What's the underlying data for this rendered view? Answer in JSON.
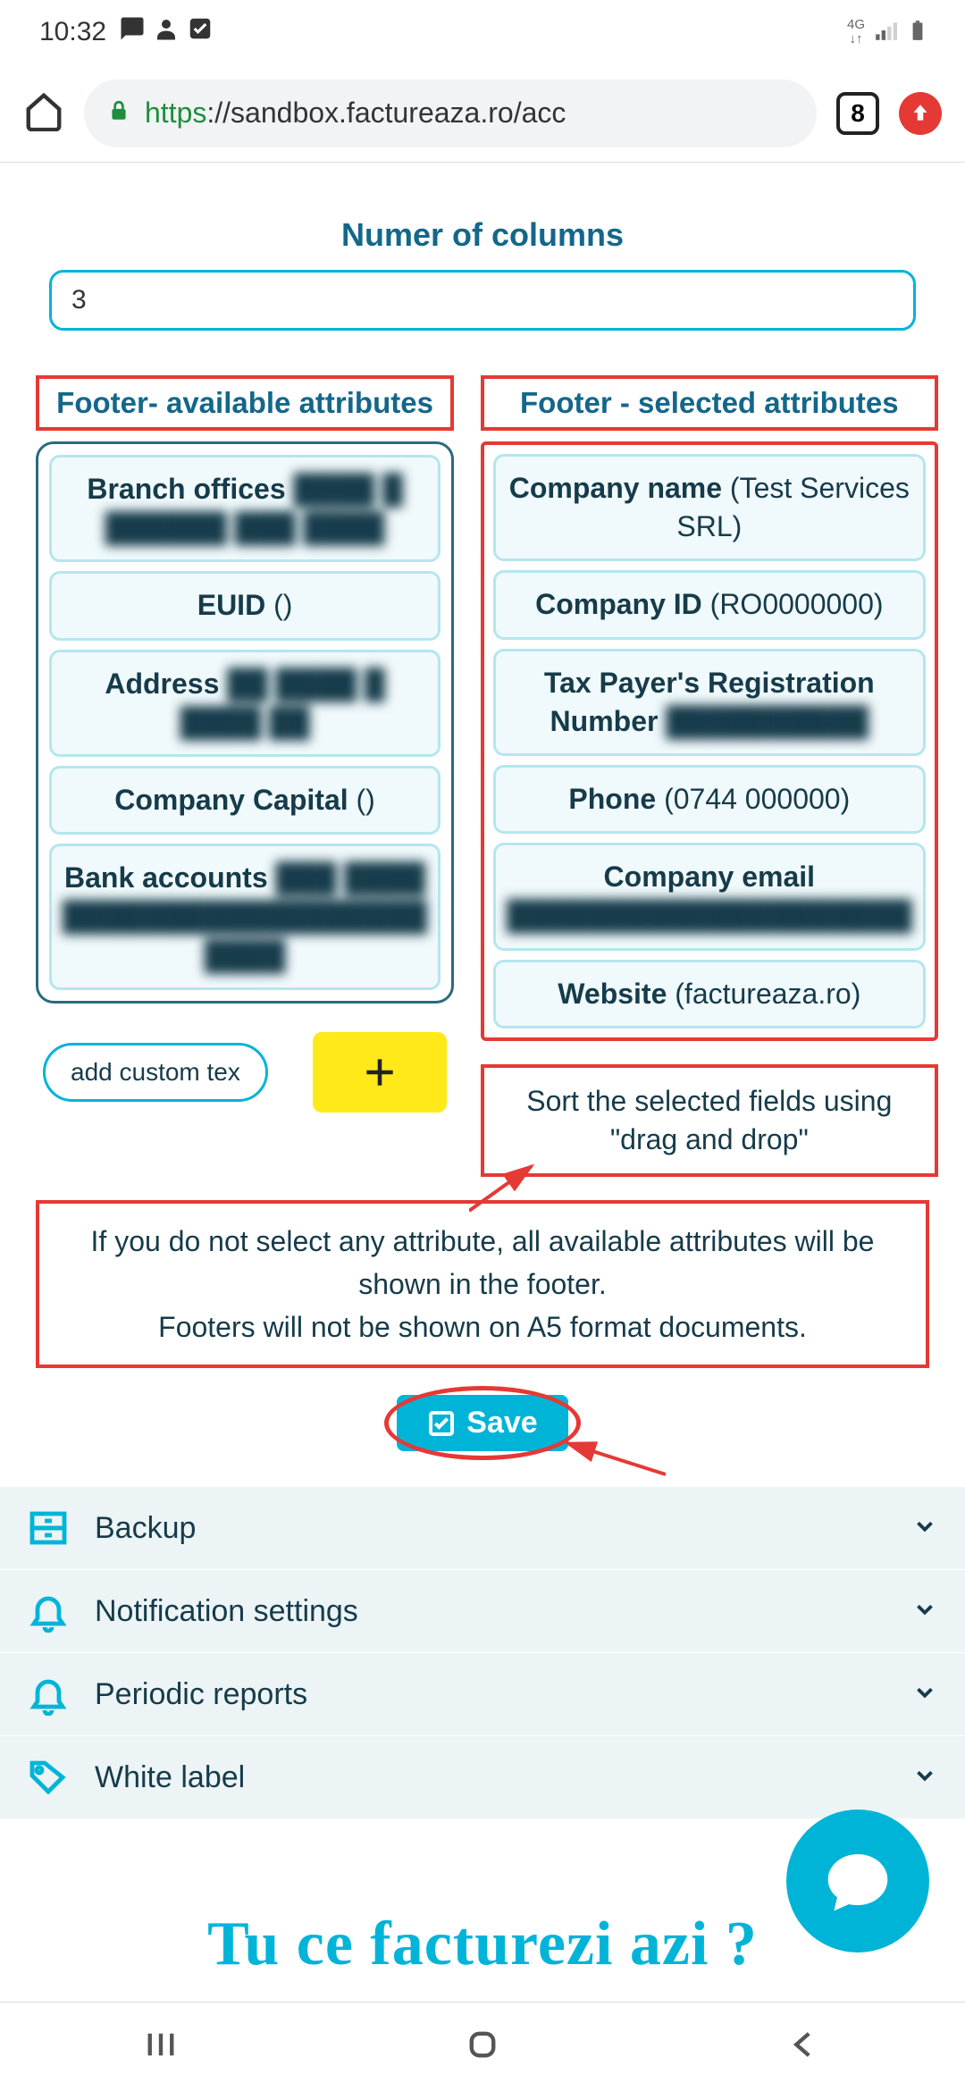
{
  "status": {
    "time": "10:32",
    "network": "4G",
    "tab_count": "8"
  },
  "browser": {
    "url_scheme": "https",
    "url_rest": "://sandbox.factureaza.ro/acc"
  },
  "section": {
    "columns_label": "Numer of columns",
    "columns_value": "3"
  },
  "available": {
    "title": "Footer- available attributes",
    "items": [
      {
        "label": "Branch offices",
        "value_blur": "████ █ ██████ ███ ████"
      },
      {
        "label": "EUID",
        "value": "()"
      },
      {
        "label": "Address",
        "value_blur": "██ ████ █ ████ ██"
      },
      {
        "label": "Company Capital",
        "value": "()"
      },
      {
        "label": "Bank accounts",
        "value_blur": "███ ████ ██████████████████ ████"
      }
    ]
  },
  "selected": {
    "title": "Footer - selected attributes",
    "items": [
      {
        "label": "Company name",
        "value": "(Test Services SRL)"
      },
      {
        "label": "Company ID",
        "value": "(RO0000000)"
      },
      {
        "label": "Tax Payer's Registration Number",
        "value_blur": "██████████"
      },
      {
        "label": "Phone",
        "value": "(0744 000000)"
      },
      {
        "label": "Company email",
        "value_blur": "████████████████████"
      },
      {
        "label": "Website",
        "value": "(factureaza.ro)"
      }
    ]
  },
  "sort_hint": "Sort the selected fields using \"drag and drop\"",
  "add_custom_label": "add custom tex",
  "info": {
    "line1": "If you do not select any attribute, all available attributes will be shown in the footer.",
    "line2": "Footers will not be shown on A5 format documents."
  },
  "save_label": "Save",
  "settings": [
    {
      "key": "backup",
      "label": "Backup",
      "icon": "drawer"
    },
    {
      "key": "notifications",
      "label": "Notification settings",
      "icon": "bell"
    },
    {
      "key": "periodic",
      "label": "Periodic reports",
      "icon": "bell"
    },
    {
      "key": "whitelabel",
      "label": "White label",
      "icon": "tag"
    }
  ],
  "slogan": "Tu ce facturezi azi ?"
}
